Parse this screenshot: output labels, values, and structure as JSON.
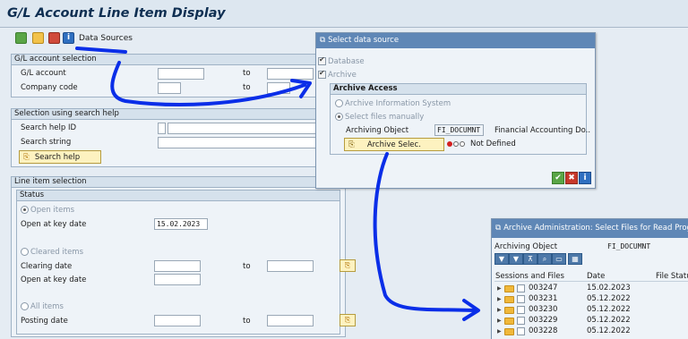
{
  "app": {
    "title": "G/L Account Line Item Display"
  },
  "toolbar": {
    "data_sources_label": "Data Sources"
  },
  "gl_selection": {
    "header": "G/L account selection",
    "gl_account_label": "G/L account",
    "company_code_label": "Company code",
    "to_label": "to"
  },
  "search_help": {
    "header": "Selection using search help",
    "id_label": "Search help ID",
    "string_label": "Search string",
    "button_label": "Search help"
  },
  "line_item": {
    "header": "Line item selection",
    "status_header": "Status",
    "open_items_label": "Open items",
    "open_at_key_date_label": "Open at key date",
    "open_at_key_date_value": "15.02.2023",
    "cleared_items_label": "Cleared items",
    "clearing_date_label": "Clearing date",
    "open_at_key_date2_label": "Open at key date",
    "all_items_label": "All items",
    "posting_date_label": "Posting date",
    "to_label": "to"
  },
  "select_source": {
    "title": "Select data source",
    "database_label": "Database",
    "archive_label": "Archive",
    "archive_access_header": "Archive Access",
    "archive_info_system_label": "Archive Information System",
    "select_files_manually_label": "Select files manually",
    "archiving_object_label": "Archiving Object",
    "archiving_object_value": "FI_DOCUMNT",
    "archiving_object_desc": "Financial Accounting Do..",
    "archive_select_button": "Archive Selec.",
    "status_text": "Not Defined"
  },
  "archive_admin": {
    "title": "Archive Administration: Select Files for Read Program",
    "archiving_object_label": "Archiving Object",
    "archiving_object_value": "FI_DOCUMNT",
    "columns": [
      "Sessions and Files",
      "Date",
      "File Status"
    ],
    "rows": [
      {
        "name": "003247",
        "date": "15.02.2023"
      },
      {
        "name": "003231",
        "date": "05.12.2022"
      },
      {
        "name": "003230",
        "date": "05.12.2022"
      },
      {
        "name": "003229",
        "date": "05.12.2022"
      },
      {
        "name": "003228",
        "date": "05.12.2022"
      }
    ]
  },
  "colors": {
    "annotation_blue": "#0a2ee8",
    "sap_title_blue": "#5f87b6",
    "button_yellow": "#fdf2c0"
  }
}
